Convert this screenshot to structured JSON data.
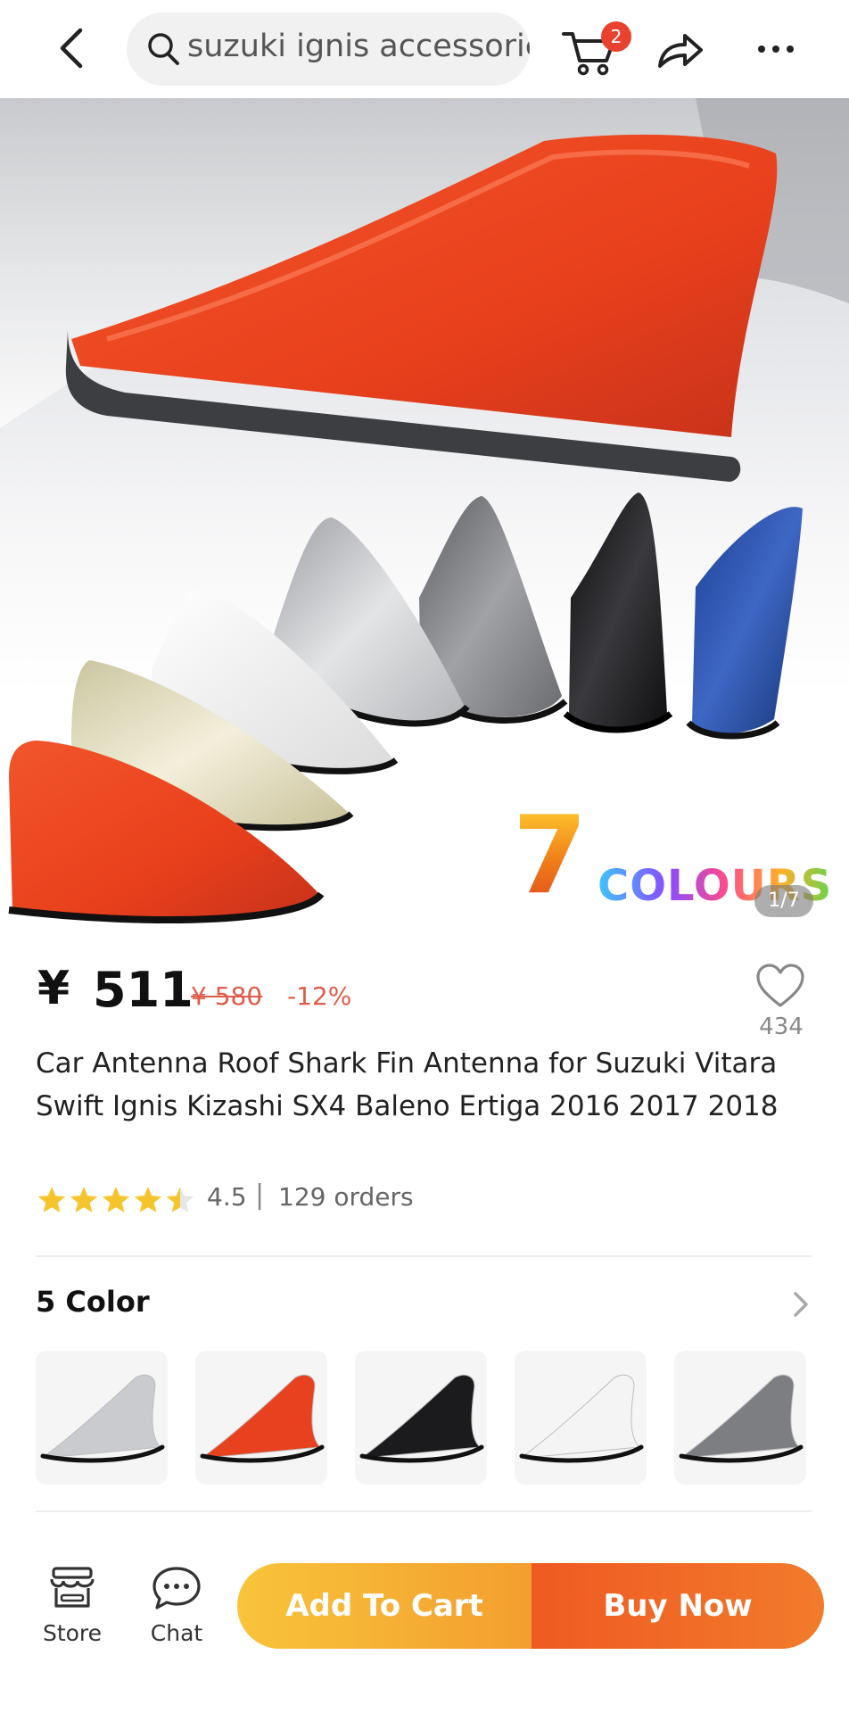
{
  "header": {
    "search_query": "suzuki ignis accessories",
    "cart_count": "2"
  },
  "hero": {
    "promo_number": "7",
    "promo_word": "COLOURS",
    "page_indicator": "1/7"
  },
  "price": {
    "currency": "¥",
    "current": "511",
    "original": "¥ 580",
    "discount": "-12%"
  },
  "wishlist": {
    "count": "434"
  },
  "product": {
    "title": "Car Antenna Roof Shark Fin Antenna for Suzuki Vitara Swift Ignis Kizashi SX4 Baleno Ertiga 2016 2017 2018"
  },
  "rating": {
    "value": "4.5",
    "stars": 4.5,
    "separator": "|",
    "orders": "129 orders"
  },
  "colors": {
    "heading": "5 Color",
    "options": [
      "silver",
      "red",
      "black",
      "white",
      "grey"
    ],
    "option_colors": [
      "#c9cbce",
      "#e8411f",
      "#1b1b1d",
      "#f4f4f4",
      "#7d7e82"
    ]
  },
  "bottom_bar": {
    "store_label": "Store",
    "chat_label": "Chat",
    "add_to_cart_label": "Add To Cart",
    "buy_now_label": "Buy Now"
  },
  "theme": {
    "accent": "#ef5a22",
    "cart_gradient": [
      "#f8c43a",
      "#f39e2f"
    ],
    "star_color": "#f6c52d",
    "discount_color": "#e05c4a"
  }
}
